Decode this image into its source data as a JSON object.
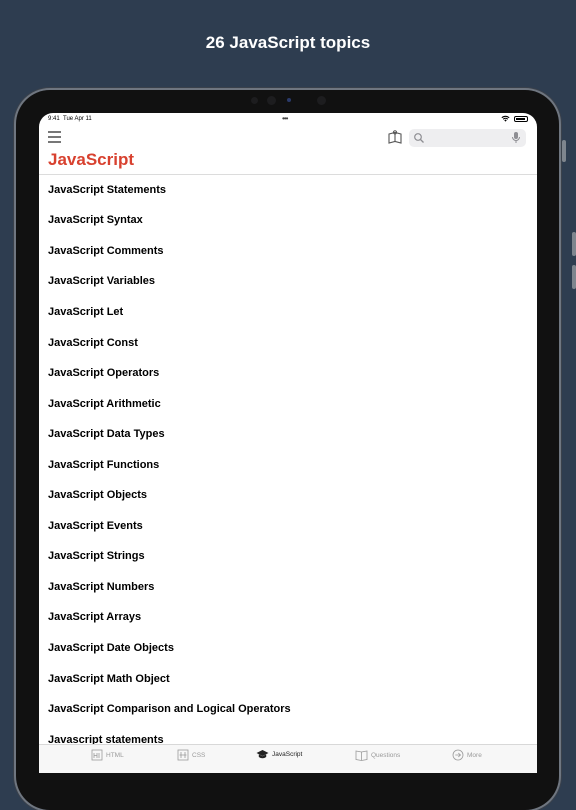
{
  "promo": {
    "title": "26 JavaScript topics"
  },
  "status_bar": {
    "time": "9:41",
    "date": "Tue Apr 11",
    "dots": "•••"
  },
  "nav": {
    "search_placeholder": "",
    "page_title": "JavaScript"
  },
  "topics": [
    "JavaScript Statements",
    "JavaScript Syntax",
    "JavaScript Comments",
    "JavaScript Variables",
    "JavaScript Let",
    "JavaScript Const",
    "JavaScript Operators",
    "JavaScript Arithmetic",
    "JavaScript Data Types",
    "JavaScript Functions",
    "JavaScript Objects",
    "JavaScript Events",
    "JavaScript Strings",
    "JavaScript Numbers",
    "JavaScript Arrays",
    "JavaScript Date Objects",
    "JavaScript Math Object",
    "JavaScript Comparison and Logical Operators",
    "Javascript statements"
  ],
  "tabs": [
    {
      "label": "HTML",
      "icon": "html-icon",
      "active": false
    },
    {
      "label": "CSS",
      "icon": "css-icon",
      "active": false
    },
    {
      "label": "JavaScript",
      "icon": "graduation-cap-icon",
      "active": true
    },
    {
      "label": "Questions",
      "icon": "open-book-icon",
      "active": false
    },
    {
      "label": "More",
      "icon": "arrow-circle-icon",
      "active": false
    }
  ],
  "colors": {
    "background": "#2e3d50",
    "accent": "#d8412f",
    "active_tab": "#222222",
    "inactive_tab": "#9a9a9a"
  }
}
